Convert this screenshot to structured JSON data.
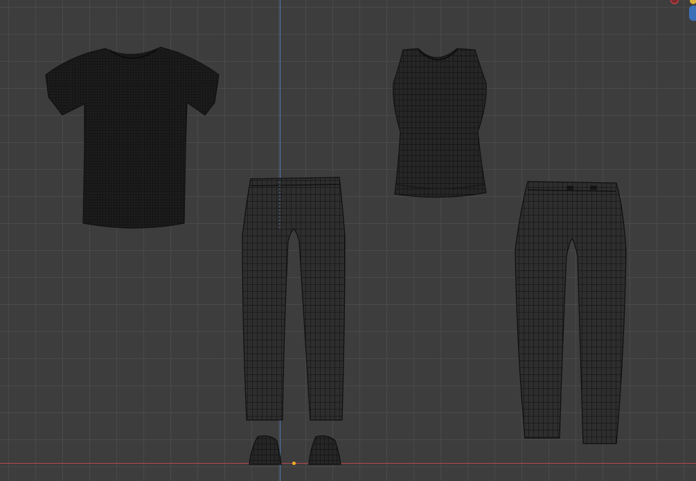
{
  "viewport": {
    "grid": "on",
    "colors": {
      "background": "#3d3d3d",
      "grid_line": "#4a4a4a",
      "z_axis": "#4f7dbf",
      "x_axis": "#b5484e",
      "origin": "#f0b024",
      "mesh_fill": "#1c1c1c",
      "wire": "#0e0e0e"
    }
  },
  "scene_objects": [
    {
      "name": "t-shirt",
      "shading": "wireframe"
    },
    {
      "name": "tank-top",
      "shading": "wireframe"
    },
    {
      "name": "jeans-front",
      "shading": "wireframe"
    },
    {
      "name": "jeans-back",
      "shading": "wireframe"
    },
    {
      "name": "shoes",
      "shading": "wireframe"
    }
  ],
  "nav_gizmo": {
    "icons": [
      "x-axis-handle-icon",
      "y-axis-handle-icon",
      "z-axis-handle-icon"
    ]
  }
}
